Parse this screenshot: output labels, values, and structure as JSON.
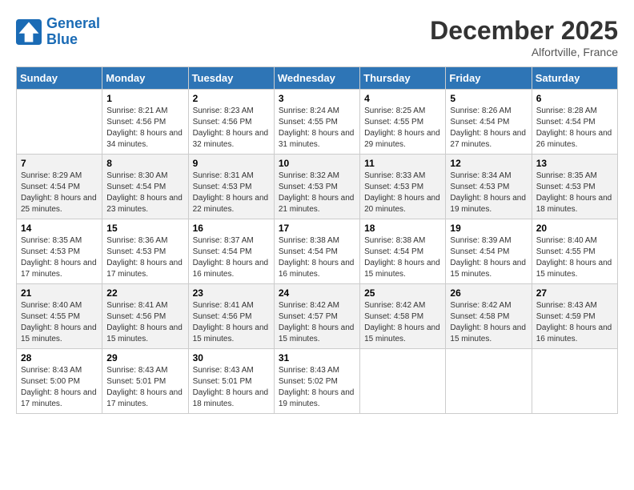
{
  "header": {
    "logo_line1": "General",
    "logo_line2": "Blue",
    "month": "December 2025",
    "location": "Alfortville, France"
  },
  "weekdays": [
    "Sunday",
    "Monday",
    "Tuesday",
    "Wednesday",
    "Thursday",
    "Friday",
    "Saturday"
  ],
  "weeks": [
    [
      {
        "day": "",
        "sunrise": "",
        "sunset": "",
        "daylight": ""
      },
      {
        "day": "1",
        "sunrise": "Sunrise: 8:21 AM",
        "sunset": "Sunset: 4:56 PM",
        "daylight": "Daylight: 8 hours and 34 minutes."
      },
      {
        "day": "2",
        "sunrise": "Sunrise: 8:23 AM",
        "sunset": "Sunset: 4:56 PM",
        "daylight": "Daylight: 8 hours and 32 minutes."
      },
      {
        "day": "3",
        "sunrise": "Sunrise: 8:24 AM",
        "sunset": "Sunset: 4:55 PM",
        "daylight": "Daylight: 8 hours and 31 minutes."
      },
      {
        "day": "4",
        "sunrise": "Sunrise: 8:25 AM",
        "sunset": "Sunset: 4:55 PM",
        "daylight": "Daylight: 8 hours and 29 minutes."
      },
      {
        "day": "5",
        "sunrise": "Sunrise: 8:26 AM",
        "sunset": "Sunset: 4:54 PM",
        "daylight": "Daylight: 8 hours and 27 minutes."
      },
      {
        "day": "6",
        "sunrise": "Sunrise: 8:28 AM",
        "sunset": "Sunset: 4:54 PM",
        "daylight": "Daylight: 8 hours and 26 minutes."
      }
    ],
    [
      {
        "day": "7",
        "sunrise": "Sunrise: 8:29 AM",
        "sunset": "Sunset: 4:54 PM",
        "daylight": "Daylight: 8 hours and 25 minutes."
      },
      {
        "day": "8",
        "sunrise": "Sunrise: 8:30 AM",
        "sunset": "Sunset: 4:54 PM",
        "daylight": "Daylight: 8 hours and 23 minutes."
      },
      {
        "day": "9",
        "sunrise": "Sunrise: 8:31 AM",
        "sunset": "Sunset: 4:53 PM",
        "daylight": "Daylight: 8 hours and 22 minutes."
      },
      {
        "day": "10",
        "sunrise": "Sunrise: 8:32 AM",
        "sunset": "Sunset: 4:53 PM",
        "daylight": "Daylight: 8 hours and 21 minutes."
      },
      {
        "day": "11",
        "sunrise": "Sunrise: 8:33 AM",
        "sunset": "Sunset: 4:53 PM",
        "daylight": "Daylight: 8 hours and 20 minutes."
      },
      {
        "day": "12",
        "sunrise": "Sunrise: 8:34 AM",
        "sunset": "Sunset: 4:53 PM",
        "daylight": "Daylight: 8 hours and 19 minutes."
      },
      {
        "day": "13",
        "sunrise": "Sunrise: 8:35 AM",
        "sunset": "Sunset: 4:53 PM",
        "daylight": "Daylight: 8 hours and 18 minutes."
      }
    ],
    [
      {
        "day": "14",
        "sunrise": "Sunrise: 8:35 AM",
        "sunset": "Sunset: 4:53 PM",
        "daylight": "Daylight: 8 hours and 17 minutes."
      },
      {
        "day": "15",
        "sunrise": "Sunrise: 8:36 AM",
        "sunset": "Sunset: 4:53 PM",
        "daylight": "Daylight: 8 hours and 17 minutes."
      },
      {
        "day": "16",
        "sunrise": "Sunrise: 8:37 AM",
        "sunset": "Sunset: 4:54 PM",
        "daylight": "Daylight: 8 hours and 16 minutes."
      },
      {
        "day": "17",
        "sunrise": "Sunrise: 8:38 AM",
        "sunset": "Sunset: 4:54 PM",
        "daylight": "Daylight: 8 hours and 16 minutes."
      },
      {
        "day": "18",
        "sunrise": "Sunrise: 8:38 AM",
        "sunset": "Sunset: 4:54 PM",
        "daylight": "Daylight: 8 hours and 15 minutes."
      },
      {
        "day": "19",
        "sunrise": "Sunrise: 8:39 AM",
        "sunset": "Sunset: 4:54 PM",
        "daylight": "Daylight: 8 hours and 15 minutes."
      },
      {
        "day": "20",
        "sunrise": "Sunrise: 8:40 AM",
        "sunset": "Sunset: 4:55 PM",
        "daylight": "Daylight: 8 hours and 15 minutes."
      }
    ],
    [
      {
        "day": "21",
        "sunrise": "Sunrise: 8:40 AM",
        "sunset": "Sunset: 4:55 PM",
        "daylight": "Daylight: 8 hours and 15 minutes."
      },
      {
        "day": "22",
        "sunrise": "Sunrise: 8:41 AM",
        "sunset": "Sunset: 4:56 PM",
        "daylight": "Daylight: 8 hours and 15 minutes."
      },
      {
        "day": "23",
        "sunrise": "Sunrise: 8:41 AM",
        "sunset": "Sunset: 4:56 PM",
        "daylight": "Daylight: 8 hours and 15 minutes."
      },
      {
        "day": "24",
        "sunrise": "Sunrise: 8:42 AM",
        "sunset": "Sunset: 4:57 PM",
        "daylight": "Daylight: 8 hours and 15 minutes."
      },
      {
        "day": "25",
        "sunrise": "Sunrise: 8:42 AM",
        "sunset": "Sunset: 4:58 PM",
        "daylight": "Daylight: 8 hours and 15 minutes."
      },
      {
        "day": "26",
        "sunrise": "Sunrise: 8:42 AM",
        "sunset": "Sunset: 4:58 PM",
        "daylight": "Daylight: 8 hours and 15 minutes."
      },
      {
        "day": "27",
        "sunrise": "Sunrise: 8:43 AM",
        "sunset": "Sunset: 4:59 PM",
        "daylight": "Daylight: 8 hours and 16 minutes."
      }
    ],
    [
      {
        "day": "28",
        "sunrise": "Sunrise: 8:43 AM",
        "sunset": "Sunset: 5:00 PM",
        "daylight": "Daylight: 8 hours and 17 minutes."
      },
      {
        "day": "29",
        "sunrise": "Sunrise: 8:43 AM",
        "sunset": "Sunset: 5:01 PM",
        "daylight": "Daylight: 8 hours and 17 minutes."
      },
      {
        "day": "30",
        "sunrise": "Sunrise: 8:43 AM",
        "sunset": "Sunset: 5:01 PM",
        "daylight": "Daylight: 8 hours and 18 minutes."
      },
      {
        "day": "31",
        "sunrise": "Sunrise: 8:43 AM",
        "sunset": "Sunset: 5:02 PM",
        "daylight": "Daylight: 8 hours and 19 minutes."
      },
      {
        "day": "",
        "sunrise": "",
        "sunset": "",
        "daylight": ""
      },
      {
        "day": "",
        "sunrise": "",
        "sunset": "",
        "daylight": ""
      },
      {
        "day": "",
        "sunrise": "",
        "sunset": "",
        "daylight": ""
      }
    ]
  ]
}
